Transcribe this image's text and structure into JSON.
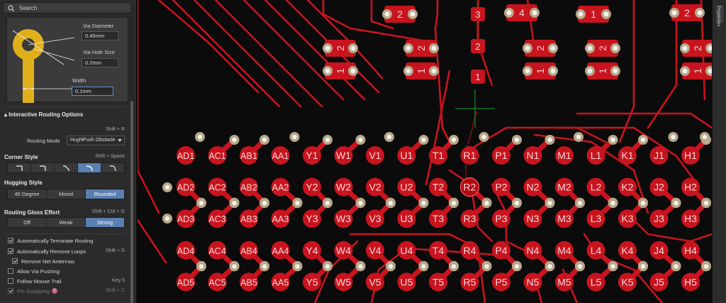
{
  "search": {
    "placeholder": "Search"
  },
  "via": {
    "diameter_label": "Via Diameter",
    "diameter_value": "0.45mm",
    "hole_label": "Via Hole Size",
    "hole_value": "0.2mm",
    "width_label": "Width",
    "width_value": "0.1mm"
  },
  "routing_options": {
    "title": "Interactive Routing Options",
    "mode_shortcut": "Shift + R",
    "mode_label": "Routing Mode",
    "mode_value": "HugNPush Obstacle"
  },
  "corner_style": {
    "title": "Corner Style",
    "shortcut": "Shift + Space",
    "selected_index": 3
  },
  "hugging_style": {
    "title": "Hugging Style",
    "options": [
      "45 Degree",
      "Mixed",
      "Rounded"
    ],
    "selected": "Rounded"
  },
  "gloss": {
    "title": "Routing Gloss Effort",
    "shortcut": "Shift + Ctrl + G",
    "options": [
      "Off",
      "Weak",
      "Strong"
    ],
    "selected": "Strong"
  },
  "checkboxes": [
    {
      "label": "Automatically Terminate Routing",
      "checked": true,
      "shortcut": ""
    },
    {
      "label": "Automatically Remove Loops",
      "checked": true,
      "shortcut": "Shift + D"
    },
    {
      "label": "Remove Net Antennas",
      "checked": true,
      "shortcut": ""
    },
    {
      "label": "Allow Via Pushing",
      "checked": false,
      "shortcut": ""
    },
    {
      "label": "Follow Mouse Trail",
      "checked": false,
      "shortcut": "Key 5"
    },
    {
      "label": "Pin Swapping",
      "checked": true,
      "shortcut": "Shift + C"
    }
  ],
  "right_tab": "Properties",
  "colors": {
    "copper": "#c8141e",
    "pad_ring": "#b8a888",
    "drill": "#f2f2f2",
    "cursor": "#1fa030",
    "panel": "#2b2b2b",
    "accent": "#5a7fb0",
    "board": "#0b0b0b",
    "via_icon": "#e0b01c"
  },
  "pcb": {
    "columns": [
      "AD",
      "AC",
      "AB",
      "AA",
      "Y",
      "W",
      "V",
      "U",
      "T",
      "R",
      "P",
      "N",
      "M",
      "L",
      "K",
      "J",
      "H"
    ],
    "rows": [
      "1",
      "2",
      "3",
      "4",
      "5"
    ],
    "highlight_pad": "R2",
    "component_labels": [
      "1",
      "2",
      "3",
      "4"
    ]
  }
}
